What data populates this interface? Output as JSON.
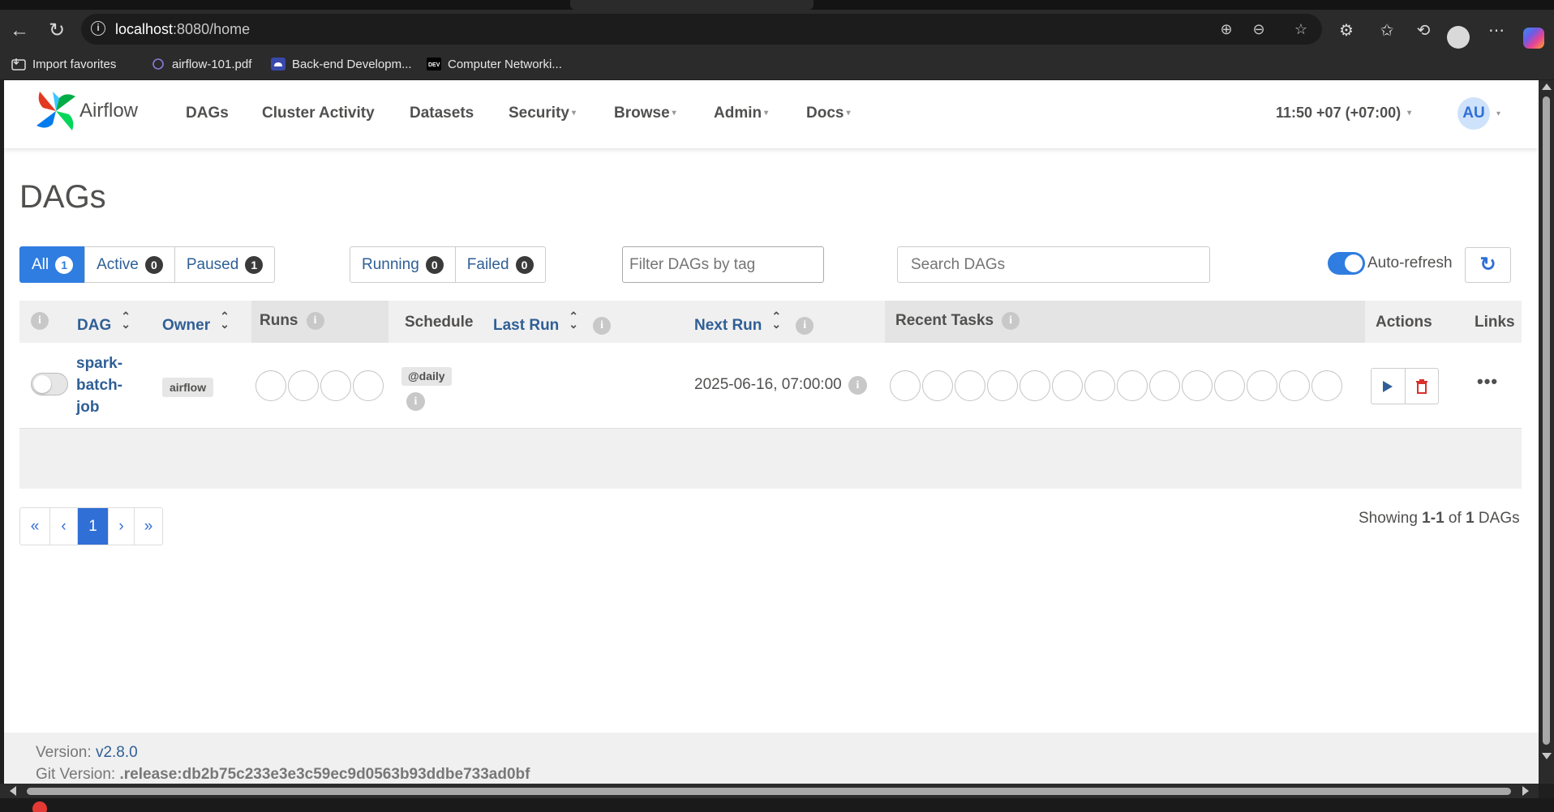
{
  "browser": {
    "url_host": "localhost",
    "url_rest": ":8080/home",
    "bookmarks": [
      {
        "label": "Import favorites",
        "icon": "import-icon"
      },
      {
        "label": "airflow-101.pdf",
        "icon": "pdf-icon"
      },
      {
        "label": "Back-end Developm...",
        "icon": "cloud-icon"
      },
      {
        "label": "Computer Networki...",
        "icon": "dev-icon"
      }
    ]
  },
  "airflow": {
    "brand": "Airflow",
    "nav": [
      "DAGs",
      "Cluster Activity",
      "Datasets",
      "Security",
      "Browse",
      "Admin",
      "Docs"
    ],
    "clock": "11:50 +07 (+07:00)",
    "avatar": "AU"
  },
  "page": {
    "title": "DAGs",
    "filters": {
      "status": [
        {
          "label": "All",
          "count": "1"
        },
        {
          "label": "Active",
          "count": "0"
        },
        {
          "label": "Paused",
          "count": "1"
        }
      ],
      "state": [
        {
          "label": "Running",
          "count": "0"
        },
        {
          "label": "Failed",
          "count": "0"
        }
      ],
      "tag_placeholder": "Filter DAGs by tag",
      "search_placeholder": "Search DAGs",
      "auto_refresh_label": "Auto-refresh",
      "auto_refresh_on": true
    },
    "table": {
      "headers": {
        "dag": "DAG",
        "owner": "Owner",
        "runs": "Runs",
        "schedule": "Schedule",
        "last_run": "Last Run",
        "next_run": "Next Run",
        "recent_tasks": "Recent Tasks",
        "actions": "Actions",
        "links": "Links"
      },
      "rows": [
        {
          "dag_id": "spark-batch-job",
          "owner": "airflow",
          "schedule": "@daily",
          "last_run": "",
          "next_run": "2025-06-16, 07:00:00",
          "paused": true,
          "runs_slots": 4,
          "recent_task_slots": 14
        }
      ]
    },
    "pagination": {
      "first": "«",
      "prev": "‹",
      "current": "1",
      "next": "›",
      "last": "»"
    },
    "showing": {
      "prefix": "Showing",
      "range": "1-1",
      "of": "of",
      "total": "1",
      "suffix": "DAGs"
    },
    "footer": {
      "version_label": "Version:",
      "version": "v2.8.0",
      "git_label": "Git Version:",
      "git": ".release:db2b75c233e3e3c59ec9d0563b93ddbe733ad0bf"
    }
  },
  "colors": {
    "primary": "#2f7de0",
    "link": "#2f5f96",
    "delete": "#d9302c"
  }
}
